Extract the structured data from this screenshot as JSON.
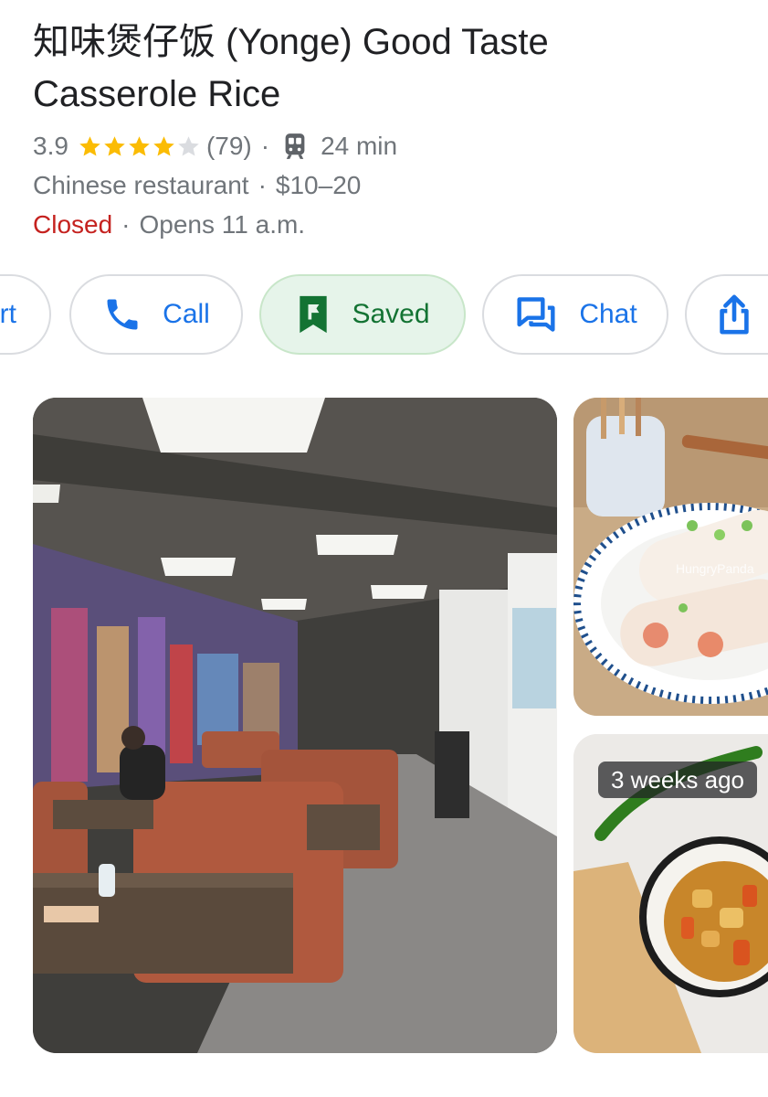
{
  "place": {
    "title_line1": "知味煲仔饭 (Yonge) Good Taste",
    "title_line2": "Casserole Rice",
    "rating": "3.9",
    "rating_stars": 3.9,
    "review_count": "(79)",
    "separator": "·",
    "travel_time": "24 min",
    "category": "Chinese restaurant",
    "price": "$10–20",
    "status": "Closed",
    "opens": "Opens 11 a.m."
  },
  "actions": {
    "directions_partial": "rt",
    "call": "Call",
    "saved": "Saved",
    "chat": "Chat"
  },
  "photos": {
    "secondary_watermark": "HungryPanda",
    "badge": "3 weeks ago"
  },
  "colors": {
    "accent_blue": "#1a73e8",
    "closed_red": "#c5221f",
    "saved_green": "#137333",
    "star_gold": "#fbbc04"
  }
}
